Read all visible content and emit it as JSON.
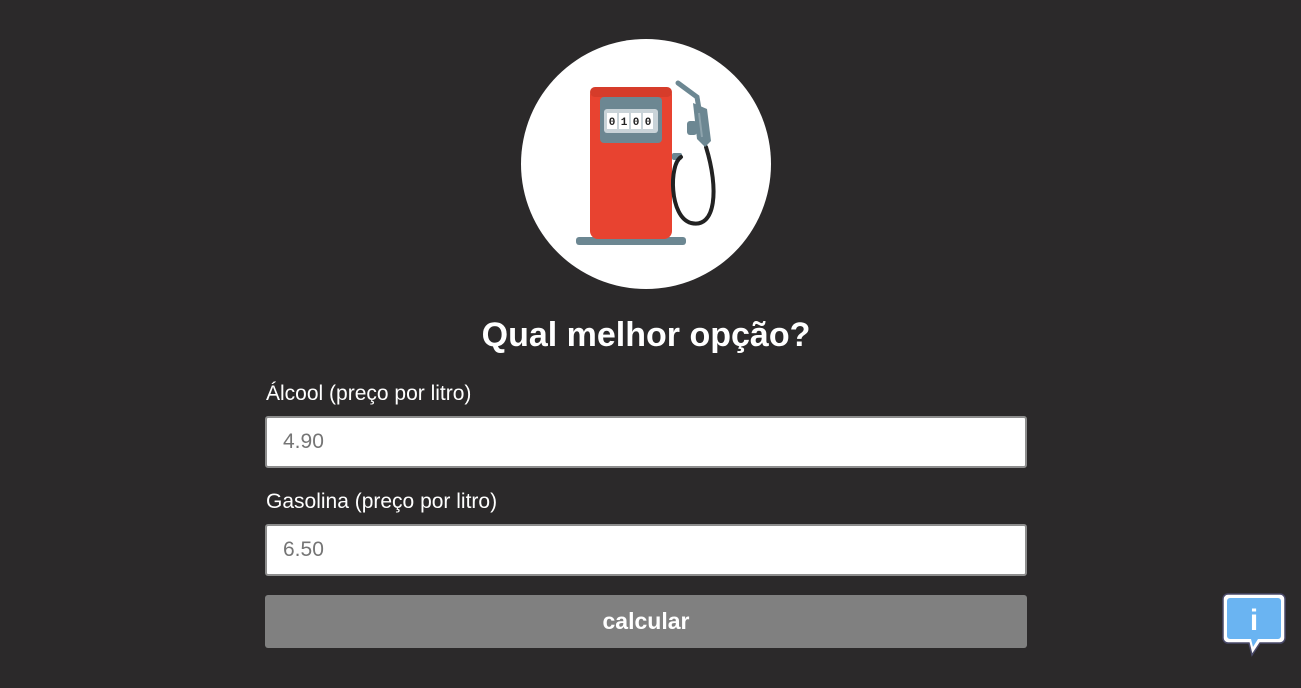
{
  "header": {
    "title": "Qual melhor opção?",
    "logo_icon": "fuel-pump-icon",
    "pump_counter": "0100"
  },
  "form": {
    "alcohol": {
      "label": "Álcool (preço por litro)",
      "placeholder": "4.90",
      "value": ""
    },
    "gasoline": {
      "label": "Gasolina (preço por litro)",
      "placeholder": "6.50",
      "value": ""
    },
    "submit_label": "calcular"
  },
  "info": {
    "icon": "info-speech-bubble-icon",
    "glyph": "i"
  },
  "colors": {
    "background": "#2b292a",
    "pump_body": "#e84330",
    "pump_gray": "#6c8792",
    "button": "#808080",
    "info_blue": "#6ab4f2"
  }
}
